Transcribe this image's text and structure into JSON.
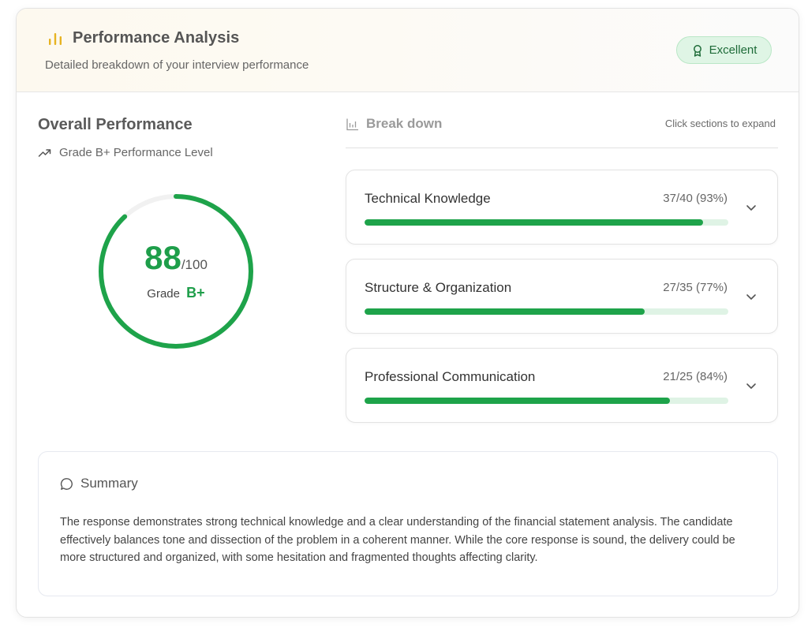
{
  "header": {
    "title": "Performance Analysis",
    "subtitle": "Detailed breakdown of your interview performance",
    "badge_label": "Excellent",
    "icon": "bar-chart-icon"
  },
  "overall": {
    "title": "Overall Performance",
    "grade_line": "Grade B+ Performance Level",
    "score": "88",
    "max": "/100",
    "grade_label": "Grade",
    "grade": "B+",
    "score_fraction": 0.88
  },
  "breakdown": {
    "title": "Break down",
    "hint": "Click sections to expand",
    "sections": [
      {
        "name": "Technical Knowledge",
        "score": "37/40 (93%)",
        "percent": 93
      },
      {
        "name": "Structure & Organization",
        "score": "27/35 (77%)",
        "percent": 77
      },
      {
        "name": "Professional Communication",
        "score": "21/25 (84%)",
        "percent": 84
      }
    ]
  },
  "summary": {
    "title": "Summary",
    "text": "The response demonstrates strong technical knowledge and a clear understanding of the financial statement analysis. The candidate effectively balances tone and dissection of the problem in a coherent manner. While the core response is sound, the delivery could be more structured and organized, with some hesitation and fragmented thoughts affecting clarity."
  },
  "colors": {
    "accent": "#1ea34a",
    "track": "#dff3e5",
    "ring_track": "#f1f1f1",
    "header_icon": "#e7b321",
    "badge_bg": "#dff5e5"
  }
}
